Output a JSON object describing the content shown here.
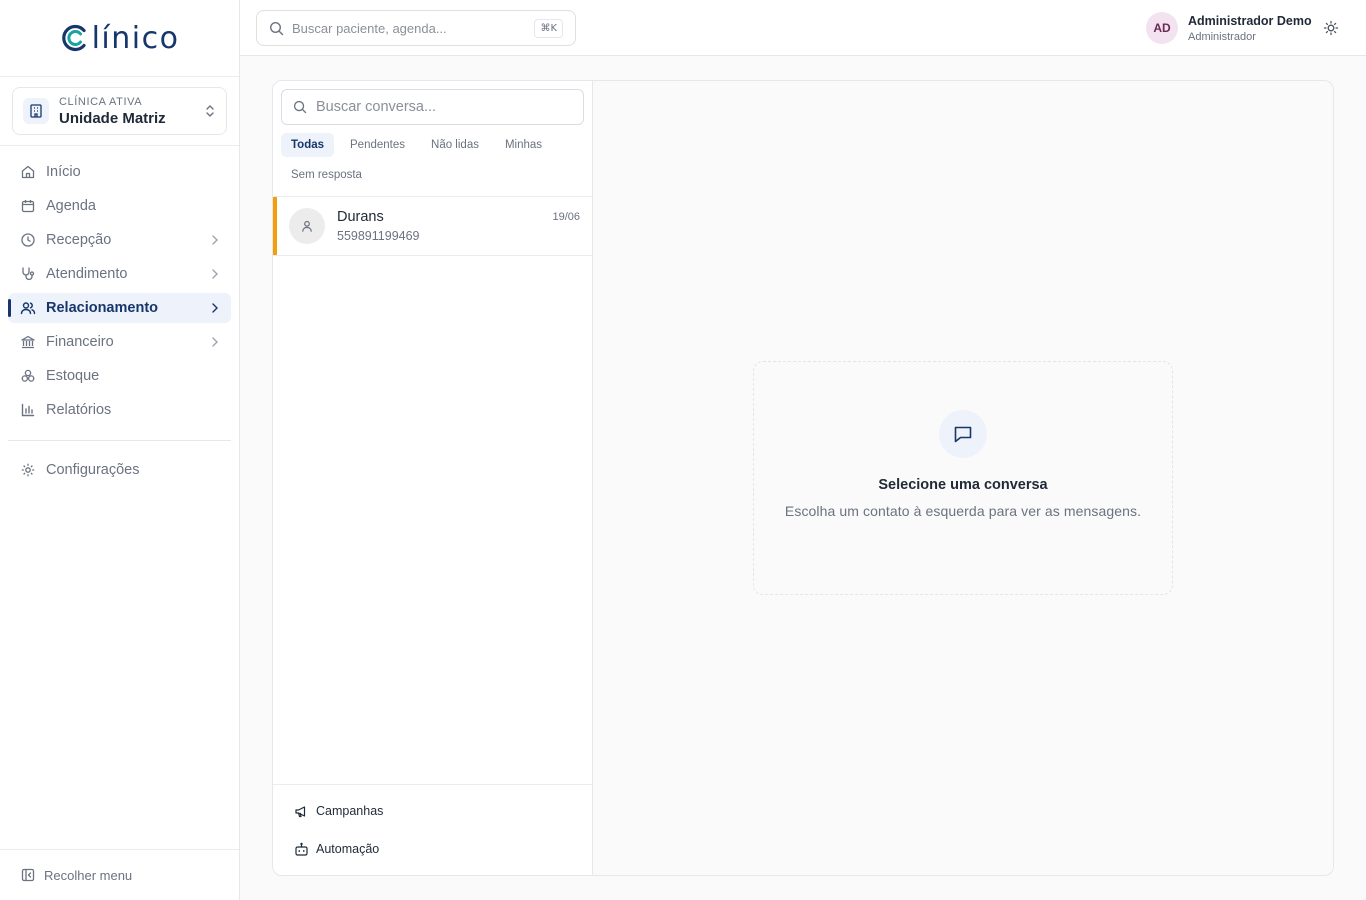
{
  "app": {
    "logo_text": "línico",
    "brand_color": "#17366b",
    "logo_accent_color": "#1aa3a0"
  },
  "sidebar": {
    "clinic": {
      "label": "CLÍNICA ATIVA",
      "name": "Unidade Matriz"
    },
    "items": [
      {
        "label": "Início",
        "icon": "home-icon",
        "has_submenu": false,
        "active": false
      },
      {
        "label": "Agenda",
        "icon": "calendar-icon",
        "has_submenu": false,
        "active": false
      },
      {
        "label": "Recepção",
        "icon": "clock-icon",
        "has_submenu": true,
        "active": false
      },
      {
        "label": "Atendimento",
        "icon": "stethoscope-icon",
        "has_submenu": true,
        "active": false
      },
      {
        "label": "Relacionamento",
        "icon": "users-icon",
        "has_submenu": true,
        "active": true
      },
      {
        "label": "Financeiro",
        "icon": "bank-icon",
        "has_submenu": true,
        "active": false
      },
      {
        "label": "Estoque",
        "icon": "boxes-icon",
        "has_submenu": false,
        "active": false
      },
      {
        "label": "Relatórios",
        "icon": "bar-chart-icon",
        "has_submenu": false,
        "active": false
      }
    ],
    "settings_label": "Configurações",
    "collapse_label": "Recolher menu"
  },
  "topbar": {
    "search_placeholder": "Buscar paciente, agenda...",
    "shortcut": "⌘K",
    "user": {
      "initials": "AD",
      "name": "Administrador Demo",
      "role": "Administrador"
    }
  },
  "conversations": {
    "search_placeholder": "Buscar conversa...",
    "filters": [
      {
        "label": "Todas",
        "active": true
      },
      {
        "label": "Pendentes",
        "active": false
      },
      {
        "label": "Não lidas",
        "active": false
      },
      {
        "label": "Minhas",
        "active": false
      },
      {
        "label": "Sem resposta",
        "active": false
      }
    ],
    "items": [
      {
        "name": "Durans",
        "phone": "559891199469",
        "date": "19/06",
        "status_color": "#f59e0b"
      }
    ],
    "bottom_links": [
      {
        "label": "Campanhas",
        "icon": "megaphone-icon"
      },
      {
        "label": "Automação",
        "icon": "bot-icon"
      }
    ]
  },
  "empty_state": {
    "title": "Selecione uma conversa",
    "subtitle": "Escolha um contato à esquerda para ver as mensagens."
  }
}
